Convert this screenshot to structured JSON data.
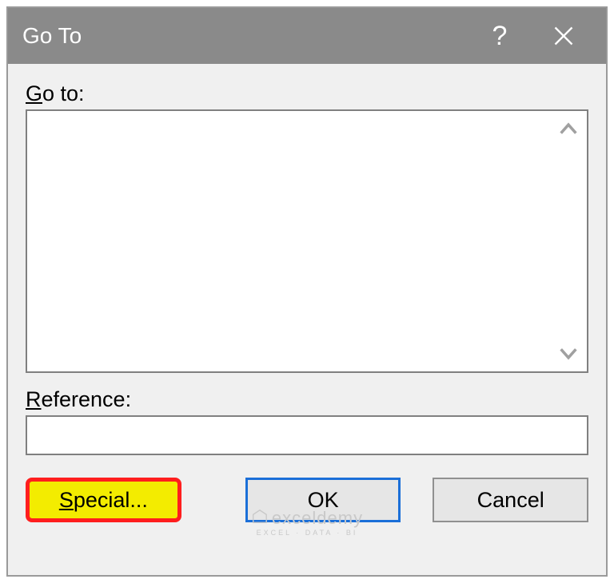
{
  "dialog": {
    "title": "Go To",
    "goto_label_prefix": "G",
    "goto_label_rest": "o to:",
    "reference_label_prefix": "R",
    "reference_label_rest": "eference:",
    "reference_value": "",
    "buttons": {
      "special_prefix": "S",
      "special_rest": "pecial...",
      "ok": "OK",
      "cancel": "Cancel"
    }
  },
  "watermark": {
    "main": "exceldemy",
    "sub": "EXCEL · DATA · BI"
  }
}
